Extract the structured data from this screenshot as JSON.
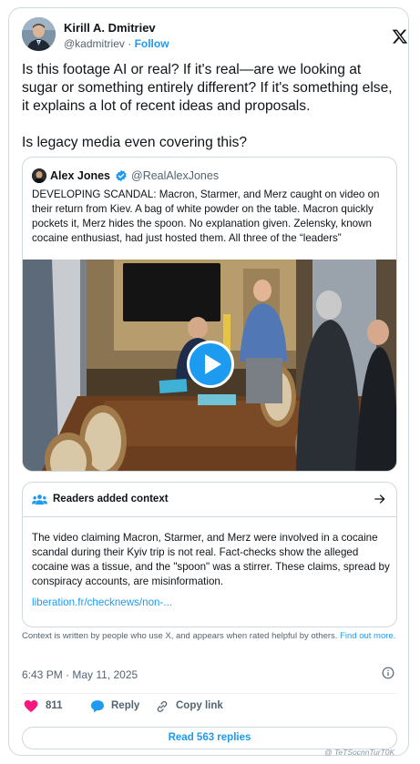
{
  "tweet": {
    "author_name": "Kirill A. Dmitriev",
    "author_handle": "@kadmitriev",
    "separator": "·",
    "follow_label": "Follow",
    "text": "Is this footage AI or real? If it's real—are we looking at sugar or something entirely different? If it's something else, it explains a lot of recent ideas and proposals.\n\nIs legacy media even covering this?",
    "timestamp": "6:43 PM · May 11, 2025",
    "likes_count": "811",
    "reply_label": "Reply",
    "copy_link_label": "Copy link",
    "read_replies_label": "Read 563 replies"
  },
  "quote": {
    "author_name": "Alex Jones",
    "author_handle": "@RealAlexJones",
    "text": "DEVELOPING SCANDAL: Macron, Starmer, and Merz caught on video on their return from Kiev. A bag of white powder on the table. Macron quickly pockets it, Merz hides the spoon. No explanation given. Zelensky, known cocaine enthusiast, had just hosted them. All three of the “leaders”"
  },
  "context": {
    "title": "Readers added context",
    "body": "The video claiming Macron, Starmer, and Merz were involved in a cocaine scandal during their Kyiv trip is not real. Fact-checks show the alleged cocaine was a tissue, and the \"spoon\" was a stirrer. These claims, spread by conspiracy accounts, are misinformation.",
    "link": "liberation.fr/checknews/non-...",
    "note": "Context is written by people who use X, and appears when rated helpful by others.",
    "find_out_more": "Find out more."
  },
  "icons": {
    "logo": "x-logo-icon",
    "verified": "verified-badge-icon",
    "play": "play-icon",
    "people": "people-icon",
    "arrow": "arrow-right-icon",
    "info": "info-icon",
    "like": "heart-icon",
    "reply": "speech-bubble-icon",
    "copy_link": "link-icon"
  },
  "colors": {
    "accent": "#1d9bf0",
    "like": "#f91880",
    "text": "#0f1419",
    "muted": "#536471",
    "border": "#cfd9de"
  },
  "watermark": "@ TeTSocnnTurT0K"
}
